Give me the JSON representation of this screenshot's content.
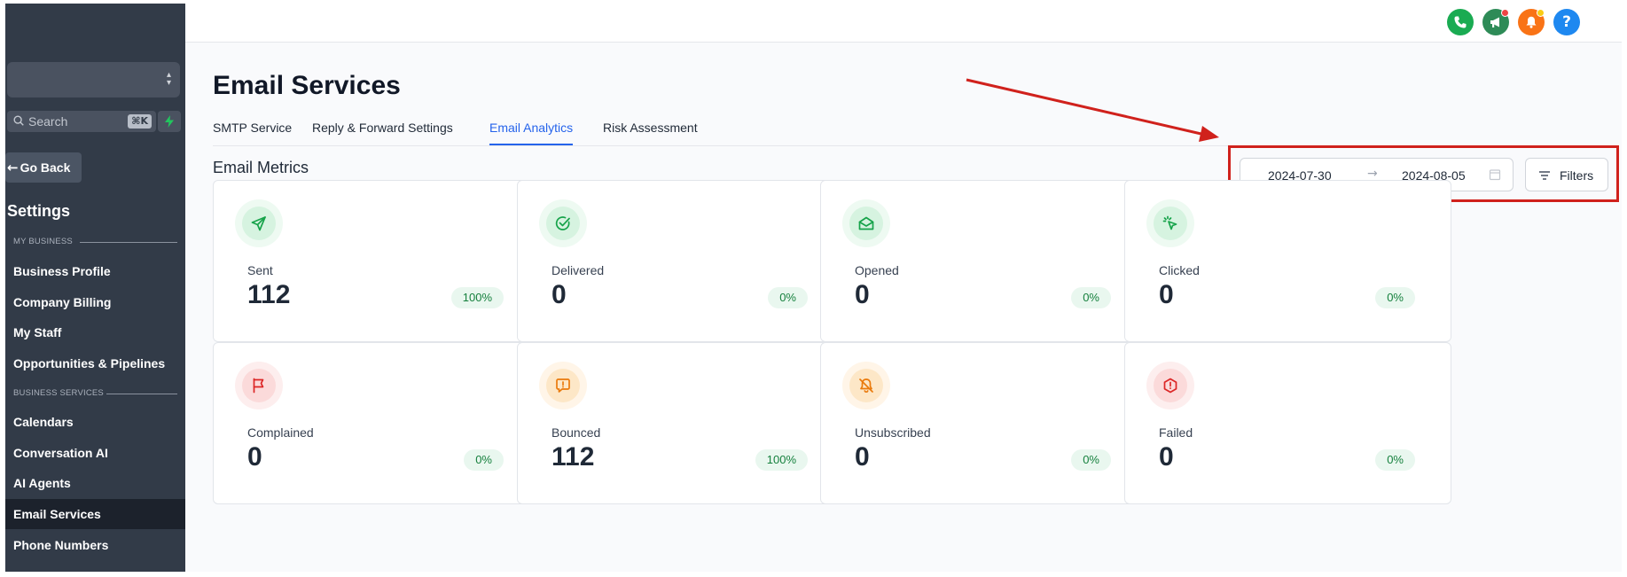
{
  "sidebar": {
    "search_placeholder": "Search",
    "search_shortcut": "⌘K",
    "go_back": "Go Back",
    "title": "Settings",
    "section_my_business": "MY BUSINESS",
    "section_business_services": "BUSINESS SERVICES",
    "items_my_business": [
      "Business Profile",
      "Company Billing",
      "My Staff",
      "Opportunities & Pipelines"
    ],
    "items_business_services": [
      "Calendars",
      "Conversation AI",
      "AI Agents",
      "Email Services",
      "Phone Numbers"
    ],
    "active_item": "Email Services"
  },
  "topbar": {
    "icons": [
      "phone-icon",
      "megaphone-icon",
      "bell-icon",
      "help-icon"
    ],
    "help_glyph": "?",
    "colors": {
      "phone": "#1aab52",
      "megaphone": "#2e8b57",
      "bell": "#f97316",
      "help": "#1e88f0"
    }
  },
  "page": {
    "title": "Email Services",
    "tabs": [
      {
        "label": "SMTP Service",
        "active": false
      },
      {
        "label": "Reply & Forward Settings",
        "active": false
      },
      {
        "label": "Email Analytics",
        "active": true
      },
      {
        "label": "Risk Assessment",
        "active": false
      }
    ],
    "section_title": "Email Metrics",
    "date_range": {
      "start": "2024-07-30",
      "end": "2024-08-05"
    },
    "filters_label": "Filters"
  },
  "metrics": [
    {
      "label": "Sent",
      "value": "112",
      "percent": "100%",
      "icon": "send-icon",
      "tone": "green"
    },
    {
      "label": "Delivered",
      "value": "0",
      "percent": "0%",
      "icon": "check-circle-icon",
      "tone": "green"
    },
    {
      "label": "Opened",
      "value": "0",
      "percent": "0%",
      "icon": "envelope-open-icon",
      "tone": "green"
    },
    {
      "label": "Clicked",
      "value": "0",
      "percent": "0%",
      "icon": "cursor-click-icon",
      "tone": "green"
    },
    {
      "label": "Complained",
      "value": "0",
      "percent": "0%",
      "icon": "flag-icon",
      "tone": "red"
    },
    {
      "label": "Bounced",
      "value": "112",
      "percent": "100%",
      "icon": "message-alert-icon",
      "tone": "orange"
    },
    {
      "label": "Unsubscribed",
      "value": "0",
      "percent": "0%",
      "icon": "bell-off-icon",
      "tone": "orange"
    },
    {
      "label": "Failed",
      "value": "0",
      "percent": "0%",
      "icon": "hexagon-alert-icon",
      "tone": "red"
    }
  ],
  "tones": {
    "green": {
      "outer": "#eefaf2",
      "inner": "#d6f3e0",
      "stroke": "#16a34a"
    },
    "red": {
      "outer": "#fdeeee",
      "inner": "#fbdada",
      "stroke": "#dc2626"
    },
    "orange": {
      "outer": "#fff5e8",
      "inner": "#fde7c7",
      "stroke": "#ea7a0c"
    }
  },
  "annotation_color": "#d0211c"
}
